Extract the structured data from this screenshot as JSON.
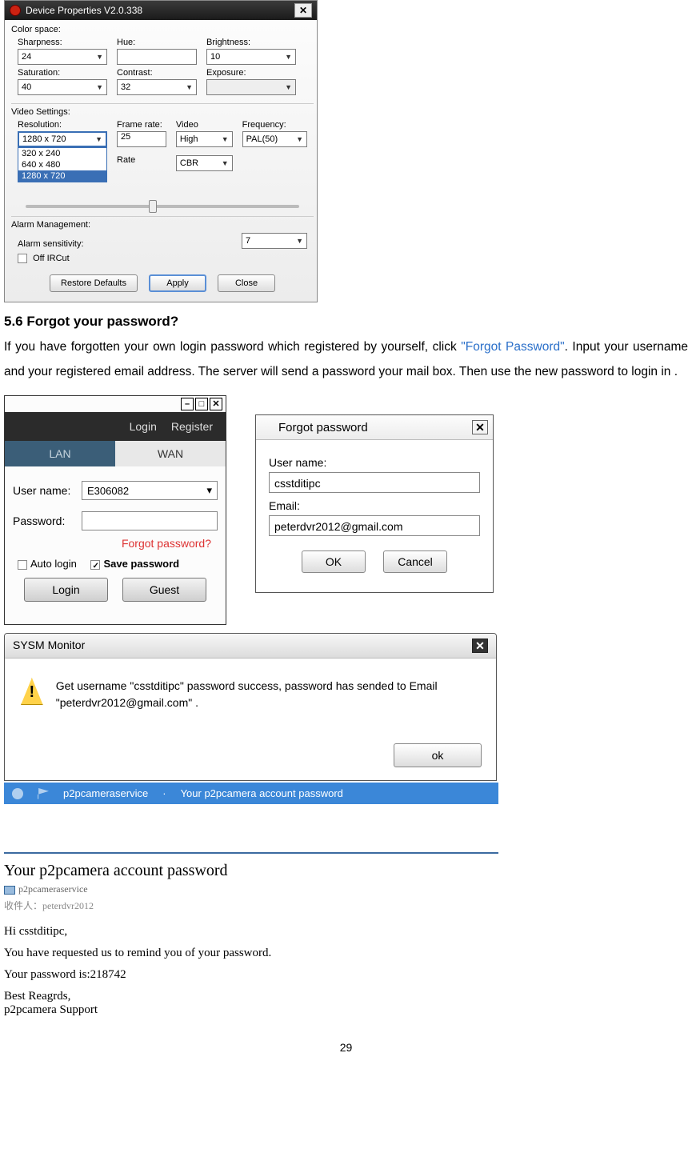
{
  "devprops": {
    "title": "Device Properties V2.0.338",
    "colorspace": "Color space:",
    "sharpness": "Sharpness:",
    "sharpness_val": "24",
    "hue": "Hue:",
    "hue_val": "",
    "brightness": "Brightness:",
    "brightness_val": "10",
    "saturation": "Saturation:",
    "saturation_val": "40",
    "contrast": "Contrast:",
    "contrast_val": "32",
    "exposure": "Exposure:",
    "exposure_val": "",
    "videosettings": "Video Settings:",
    "resolution": "Resolution:",
    "resolution_val": "1280 x 720",
    "res_opts": [
      "320 x 240",
      "640 x 480",
      "1280 x 720"
    ],
    "framerate": "Frame rate:",
    "framerate_val": "25",
    "video": "Video",
    "video_val": "High",
    "frequency": "Frequency:",
    "frequency_val": "PAL(50)",
    "rate": "Rate",
    "rate_val": "CBR",
    "alarm_mgmt": "Alarm Management:",
    "alarm_sens": "Alarm sensitivity:",
    "alarm_sens_val": "7",
    "offircut": "Off IRCut",
    "btn_restore": "Restore Defaults",
    "btn_apply": "Apply",
    "btn_close": "Close"
  },
  "doc": {
    "heading": "5.6 Forgot your password?",
    "p1a": "If you have forgotten your own login password which registered by yourself, click ",
    "p1b": "\"Forgot Password\"",
    "p1c": ". Input your username and your registered email address. The server will send a password your mail box. Then use the new password to login in .",
    "page": "29"
  },
  "login": {
    "login": "Login",
    "register": "Register",
    "tab_lan": "LAN",
    "tab_wan": "WAN",
    "user_label": "User name:",
    "user_val": "E306082",
    "pass_label": "Password:",
    "pass_val": "",
    "forgot": "Forgot password?",
    "auto": "Auto login",
    "save": "Save password",
    "btn_login": "Login",
    "btn_guest": "Guest"
  },
  "fp": {
    "title": "Forgot password",
    "user_label": "User name:",
    "user_val": "csstditipc",
    "email_label": "Email:",
    "email_val": "peterdvr2012@gmail.com",
    "ok": "OK",
    "cancel": "Cancel"
  },
  "sysm": {
    "title": "SYSM Monitor",
    "msg": "Get username \"csstditipc\" password success, password has sended to Email \"peterdvr2012@gmail.com\" .",
    "ok": "ok"
  },
  "mailrow": {
    "sender": "p2pcameraservice",
    "dot": "·",
    "subj": "Your   p2pcamera account password"
  },
  "email": {
    "subject": "Your   p2pcamera account password",
    "from": "p2pcameraservice",
    "to_label": "收件人：",
    "to": "peterdvr2012",
    "l1": "Hi csstditipc,",
    "l2": "You have requested us to remind you of your password.",
    "l3": "Your password is:218742",
    "l4": "Best Reagrds,",
    "l5": "p2pcamera Support"
  }
}
